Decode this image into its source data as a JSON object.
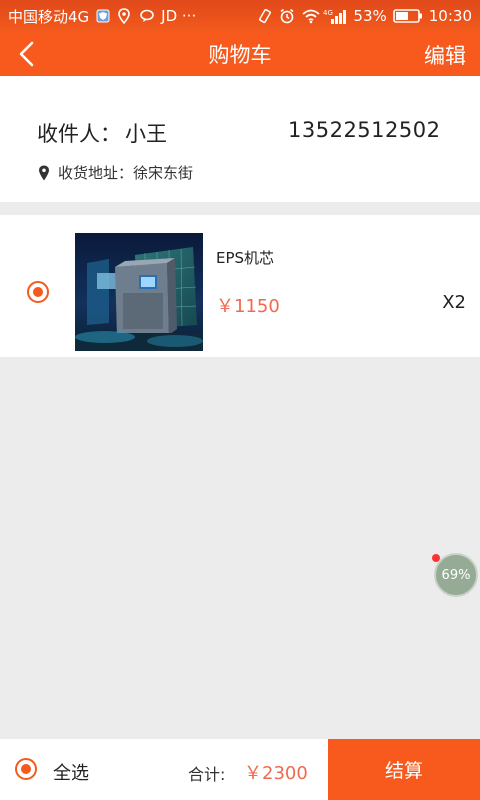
{
  "status_bar": {
    "carrier": "中国移动4G",
    "extra": "JD ···",
    "network": "4G",
    "battery": "53%",
    "time": "10:30"
  },
  "nav": {
    "title": "购物车",
    "edit_label": "编辑"
  },
  "address": {
    "recipient_label": "收件人：",
    "recipient_name": "小王",
    "phone": "13522512502",
    "address_text": "收货地址：徐宋东街"
  },
  "cart_items": [
    {
      "name": "EPS机芯",
      "price": "￥1150",
      "quantity": "X2",
      "selected": true
    }
  ],
  "float_badge": "69%",
  "footer": {
    "select_all_label": "全选",
    "total_label": "合计:",
    "total_value": "￥2300",
    "checkout_label": "结算"
  },
  "colors": {
    "accent": "#f75a1c",
    "price": "#f06a50",
    "background": "#ececec"
  }
}
